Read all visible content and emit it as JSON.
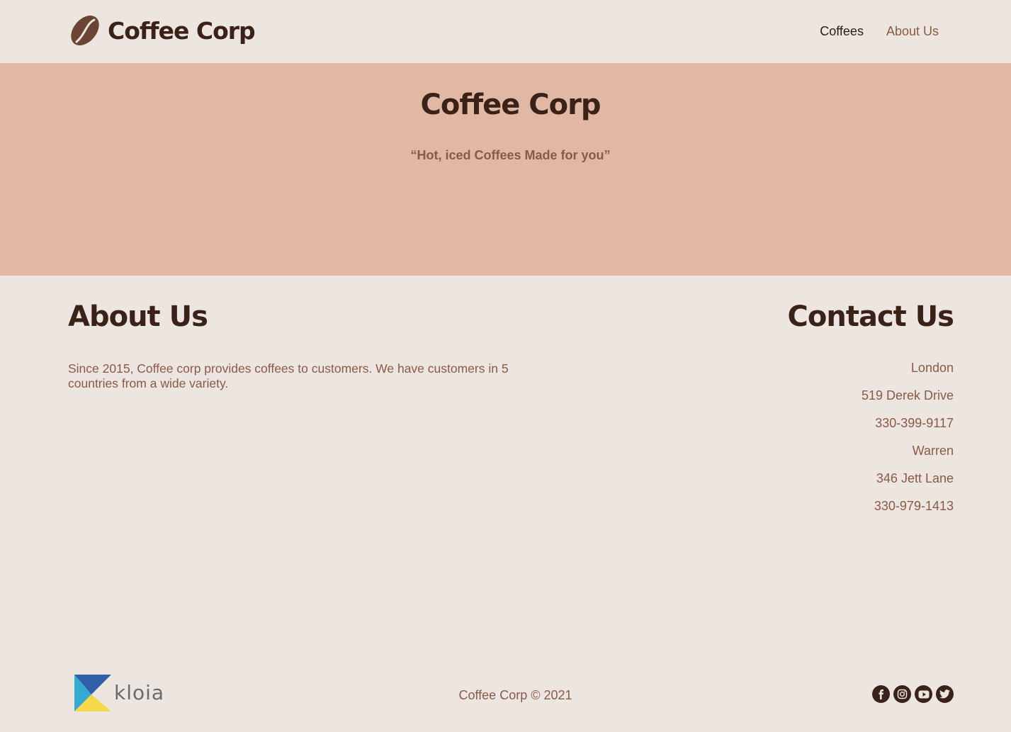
{
  "header": {
    "logo_text": "Coffee Corp",
    "nav": [
      {
        "label": "Coffees",
        "active": true
      },
      {
        "label": "About Us",
        "active": false
      }
    ]
  },
  "hero": {
    "title": "Coffee Corp",
    "subtitle": "“Hot, iced Coffees Made for you”"
  },
  "about": {
    "heading": "About Us",
    "text": "Since 2015, Coffee corp provides coffees to customers. We have customers in 5 countries from a wide variety."
  },
  "contact": {
    "heading": "Contact Us",
    "lines": [
      "London",
      "519 Derek Drive",
      "330-399-9117",
      "Warren",
      "346 Jett Lane",
      "330-979-1413"
    ]
  },
  "footer": {
    "partner_logo_text": "kloia",
    "copyright": "Coffee Corp © 2021",
    "social": [
      "facebook-icon",
      "instagram-icon",
      "youtube-icon",
      "twitter-icon"
    ]
  },
  "colors": {
    "background": "#ede5df",
    "hero": "#e0b8a3",
    "heading": "#3b2218",
    "text": "#8a5a48"
  }
}
